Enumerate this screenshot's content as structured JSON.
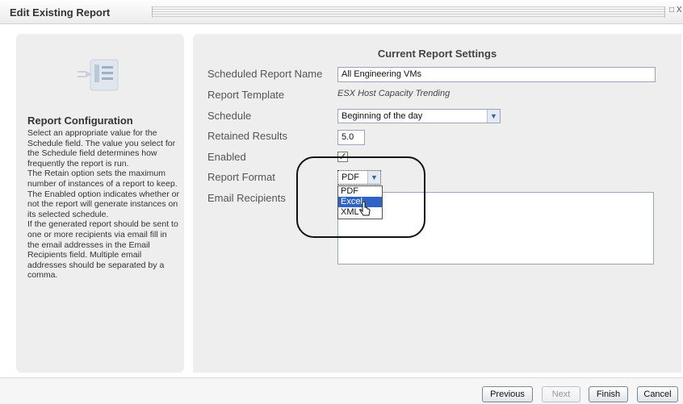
{
  "window": {
    "title": "Edit Existing Report",
    "control": "□ X"
  },
  "left": {
    "heading": "Report Configuration",
    "description": "Select an appropriate value for the Schedule field. The value you select for the Schedule field determines how frequently the report is run.\nThe Retain option sets the maximum number of instances of a report to keep.\nThe Enabled option indicates whether or not the report will generate instances on its selected schedule.\nIf the generated report should be sent to one or more recipients via email fill in the email addresses in the Email Recipients field. Multiple email addresses should be separated by a comma.",
    "icon": "report-config-icon"
  },
  "settings": {
    "heading": "Current Report Settings",
    "name_label": "Scheduled Report Name",
    "name_value": "All Engineering VMs",
    "template_label": "Report Template",
    "template_value": "ESX Host Capacity Trending",
    "schedule_label": "Schedule",
    "schedule_value": "Beginning of the day",
    "retained_label": "Retained Results",
    "retained_value": "5.0",
    "enabled_label": "Enabled",
    "enabled_checked": true,
    "format_label": "Report Format",
    "format_value": "PDF",
    "format_options": [
      "PDF",
      "Excel",
      "XML"
    ],
    "format_highlighted": "Excel",
    "email_label": "Email Recipients",
    "email_value": ""
  },
  "footer": {
    "previous": "Previous",
    "next": "Next",
    "finish": "Finish",
    "cancel": "Cancel"
  },
  "colors": {
    "panel_bg": "#eeeeee",
    "highlight": "#3163c5",
    "check": "#1c7a2b"
  }
}
